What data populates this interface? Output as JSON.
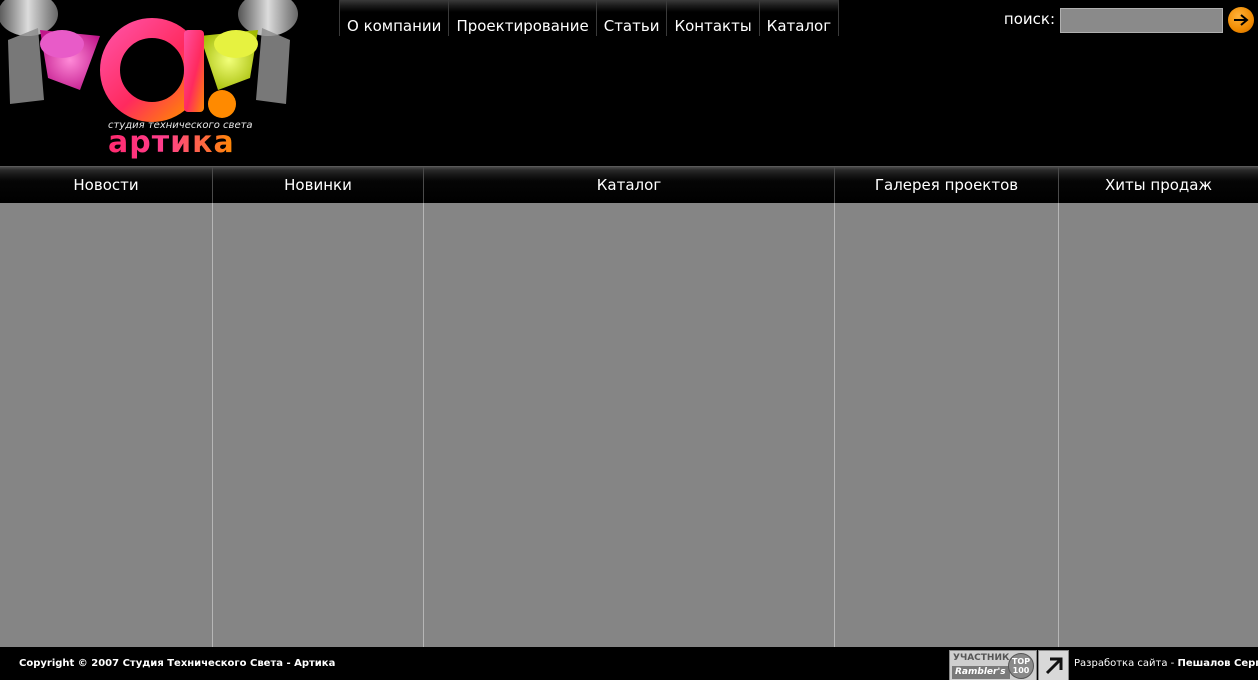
{
  "logo": {
    "caption": "студия технического света",
    "name": "артика"
  },
  "topnav": {
    "items": [
      "О компании",
      "Проектирование",
      "Статьи",
      "Контакты",
      "Каталог"
    ]
  },
  "search": {
    "label": "поиск:",
    "value": "",
    "icon": "arrow-right-icon"
  },
  "columns": {
    "headers": [
      "Новости",
      "Новинки",
      "Каталог",
      "Галерея проектов",
      "Хиты продаж"
    ]
  },
  "footer": {
    "copyright": "Copyright © 2007 Студия Технического Света - Артика",
    "rambler_top": "УЧАСТНИК",
    "rambler_bottom": "Rambler's",
    "rambler_circle_1": "TOP",
    "rambler_circle_2": "100",
    "dev_label": "Разработка сайта - ",
    "dev_name": "Пешалов Сергей"
  },
  "colors": {
    "background": "#000000",
    "content_gray": "#858585",
    "accent_orange": "#f08a00",
    "logo_pink": "#ff2a6e",
    "logo_yellow": "#d6e800"
  }
}
